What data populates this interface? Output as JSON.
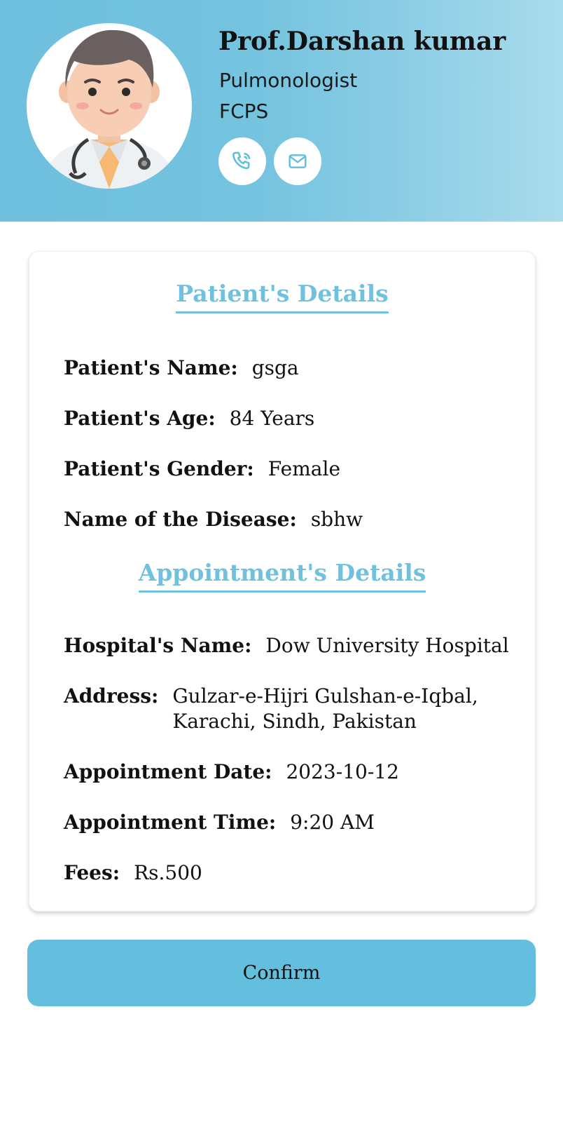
{
  "doctor": {
    "name": "Prof.Darshan kumar",
    "specialty": "Pulmonologist",
    "degree": "FCPS",
    "call_icon": "phone-icon",
    "mail_icon": "mail-icon"
  },
  "patient_section": {
    "title": "Patient's Details",
    "name_label": "Patient's Name:",
    "name_value": "gsga",
    "age_label": "Patient's Age:",
    "age_value": "84 Years",
    "gender_label": "Patient's Gender:",
    "gender_value": "Female",
    "disease_label": "Name of the Disease:",
    "disease_value": "sbhw"
  },
  "appointment_section": {
    "title": "Appointment's Details",
    "hospital_label": "Hospital's Name:",
    "hospital_value": "Dow University Hospital",
    "address_label": "Address:",
    "address_value": "Gulzar-e-Hijri Gulshan-e-Iqbal, Karachi, Sindh, Pakistan",
    "date_label": "Appointment Date:",
    "date_value": "2023-10-12",
    "time_label": "Appointment Time:",
    "time_value": "9:20 AM",
    "fees_label": "Fees:",
    "fees_value": "Rs.500"
  },
  "actions": {
    "confirm_label": "Confirm"
  },
  "colors": {
    "accent": "#6fc1de",
    "button": "#63bfdd"
  }
}
